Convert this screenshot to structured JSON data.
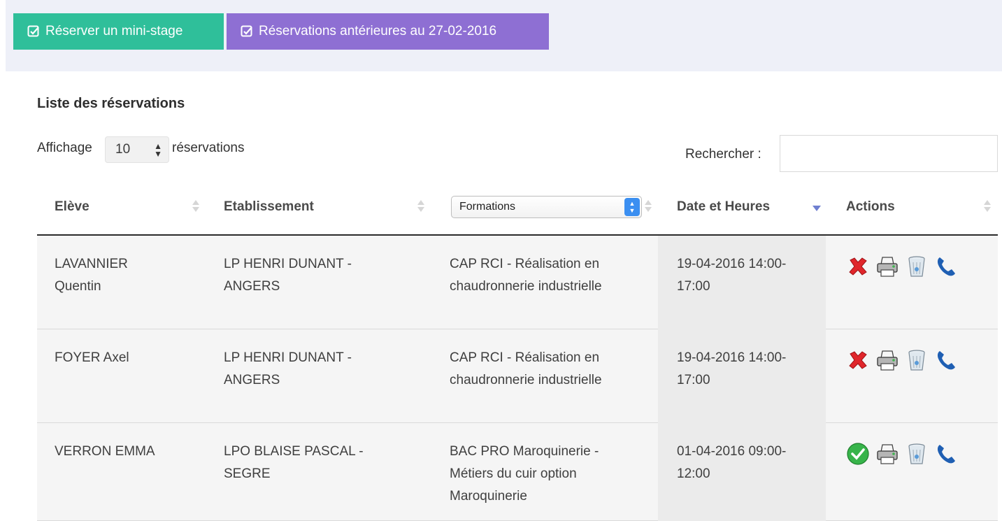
{
  "buttons": {
    "reserve": "Réserver un mini-stage",
    "previous": "Réservations antérieures au 27-02-2016"
  },
  "list": {
    "title": "Liste des réservations",
    "display_prefix": "Affichage",
    "page_length": "10",
    "display_suffix": "réservations",
    "search_label": "Rechercher :",
    "search_value": ""
  },
  "columns": {
    "student": "Elève",
    "school": "Etablissement",
    "formations_filter": "Formations",
    "datetime": "Date et Heures",
    "actions": "Actions"
  },
  "rows": [
    {
      "student": [
        "LAVANNIER",
        "Quentin"
      ],
      "school": [
        "LP HENRI DUNANT -",
        "ANGERS"
      ],
      "formation": [
        "CAP RCI - Réalisation en",
        "chaudronnerie industrielle"
      ],
      "datetime": [
        "19-04-2016 14:00-",
        "17:00"
      ],
      "status_icon": "cross-icon"
    },
    {
      "student": [
        "FOYER Axel"
      ],
      "school": [
        "LP HENRI DUNANT -",
        "ANGERS"
      ],
      "formation": [
        "CAP RCI - Réalisation en",
        "chaudronnerie industrielle"
      ],
      "datetime": [
        "19-04-2016 14:00-",
        "17:00"
      ],
      "status_icon": "cross-icon"
    },
    {
      "student": [
        "VERRON EMMA"
      ],
      "school": [
        "LPO BLAISE PASCAL -",
        "SEGRE"
      ],
      "formation": [
        "BAC PRO Maroquinerie -",
        "Métiers du cuir option",
        "Maroquinerie"
      ],
      "datetime": [
        "01-04-2016 09:00-",
        "12:00"
      ],
      "status_icon": "check-icon"
    }
  ],
  "icons": [
    "checkbox-icon",
    "cross-icon",
    "check-icon",
    "printer-icon",
    "trash-icon",
    "phone-icon",
    "sort-icon",
    "sort-desc-icon"
  ],
  "colors": {
    "green_button": "#2fbf9a",
    "purple_button": "#8e6fd3",
    "top_band": "#eef0f8",
    "row_bg": "#f5f5f5",
    "sorted_column_bg": "#ebebeb",
    "phone": "#1f5fb3"
  }
}
